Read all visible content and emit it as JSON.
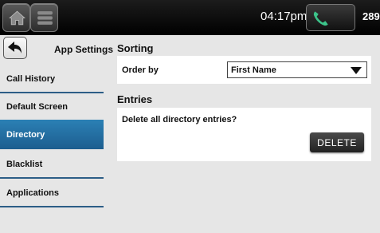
{
  "status_bar": {
    "time": "04:17pm",
    "extension": "289"
  },
  "nav": {
    "title": "App Settings",
    "items": [
      {
        "label": "Call History"
      },
      {
        "label": "Default Screen"
      },
      {
        "label": "Directory"
      },
      {
        "label": "Blacklist"
      },
      {
        "label": "Applications"
      }
    ],
    "active": "Directory"
  },
  "sorting": {
    "heading": "Sorting",
    "order_by_label": "Order by",
    "order_by_value": "First Name"
  },
  "entries": {
    "heading": "Entries",
    "prompt": "Delete all directory entries?",
    "delete_label": "DELETE"
  },
  "colors": {
    "accent": "#2b80b5",
    "divider": "#2d5e87",
    "call_icon": "#3cc48a"
  },
  "icons": [
    "home-icon",
    "menu-icon",
    "phone-icon",
    "back-arrow-icon",
    "dropdown-triangle-icon"
  ]
}
